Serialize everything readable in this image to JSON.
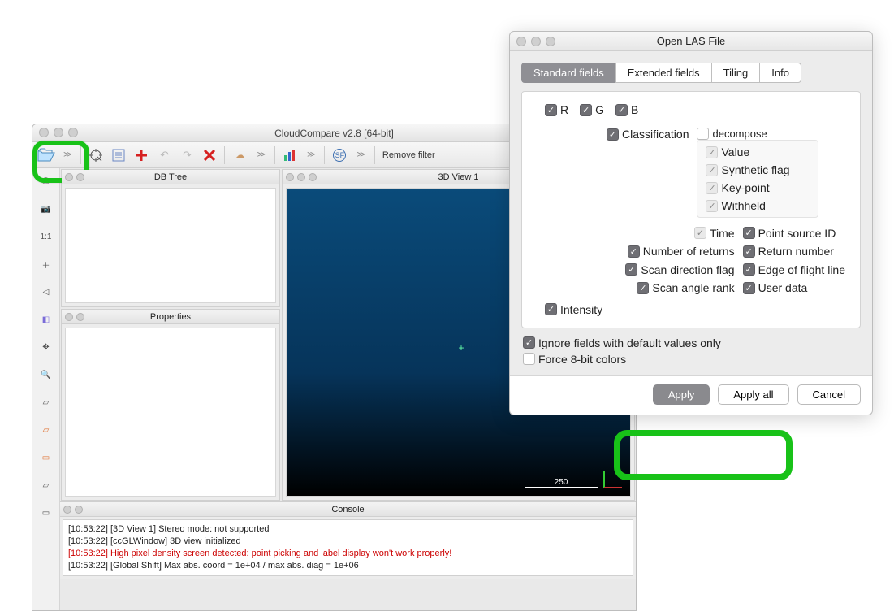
{
  "cc": {
    "title": "CloudCompare v2.8 [64-bit]",
    "toolbar_remove": "Remove filter",
    "panels": {
      "db": "DB Tree",
      "props": "Properties",
      "view": "3D View 1",
      "console": "Console"
    },
    "side_label_11": "1:1",
    "view_scale": "250",
    "console_lines": [
      {
        "t": "[10:53:22] [3D View 1] Stereo mode: not supported",
        "c": ""
      },
      {
        "t": "[10:53:22] [ccGLWindow] 3D view initialized",
        "c": ""
      },
      {
        "t": "[10:53:22] High pixel density screen detected: point picking and label display won't work properly!",
        "c": "red"
      },
      {
        "t": "[10:53:22] [Global Shift] Max abs. coord = 1e+04 / max abs. diag = 1e+06",
        "c": ""
      }
    ]
  },
  "las": {
    "title": "Open LAS File",
    "tabs": {
      "standard": "Standard fields",
      "extended": "Extended fields",
      "tiling": "Tiling",
      "info": "Info"
    },
    "rgb": {
      "r": "R",
      "g": "G",
      "b": "B"
    },
    "classification": "Classification",
    "decompose": "decompose",
    "class_opts": {
      "value": "Value",
      "synthetic": "Synthetic flag",
      "keypoint": "Key-point",
      "withheld": "Withheld"
    },
    "fields": {
      "time": "Time",
      "psid": "Point source ID",
      "nreturns": "Number of returns",
      "retnum": "Return number",
      "scandir": "Scan direction flag",
      "edge": "Edge of flight line",
      "scanang": "Scan angle rank",
      "userdata": "User data"
    },
    "intensity": "Intensity",
    "ignore": "Ignore fields with default values only",
    "force8": "Force 8-bit colors",
    "buttons": {
      "apply": "Apply",
      "applyall": "Apply all",
      "cancel": "Cancel"
    }
  }
}
